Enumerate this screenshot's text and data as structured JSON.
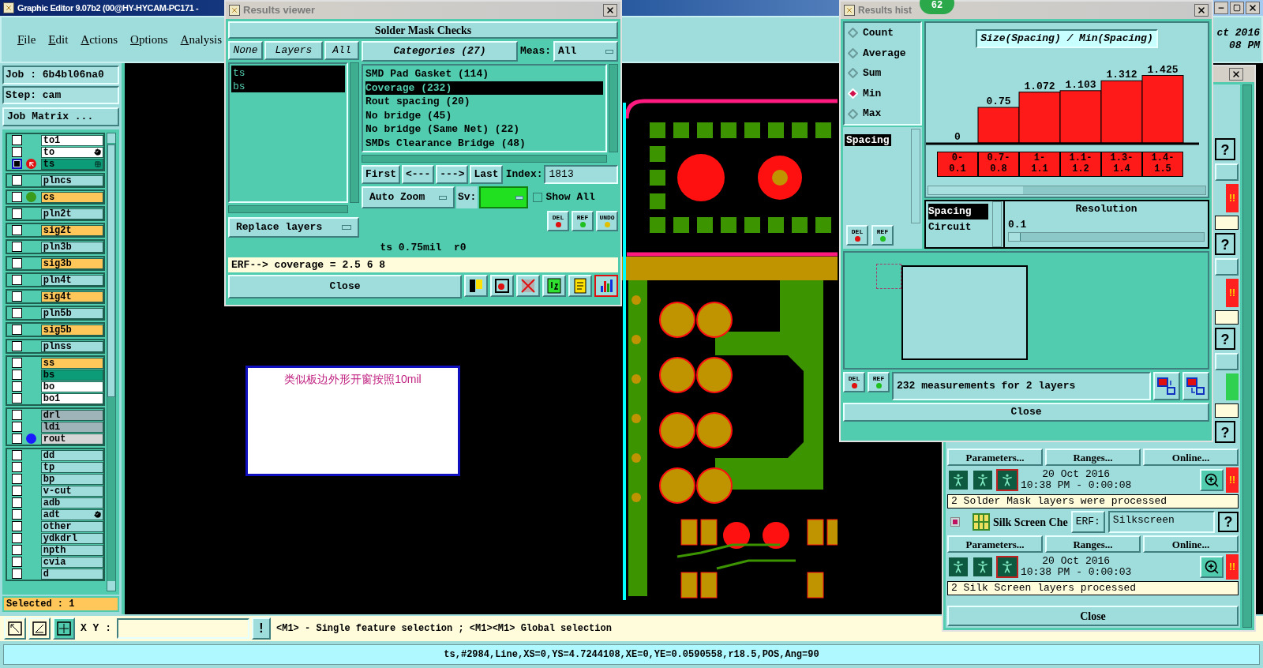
{
  "main_window": {
    "title": "Graphic Editor 9.07b2 (00@HY-HYCAM-PC171 -",
    "menu": [
      "File",
      "Edit",
      "Actions",
      "Options",
      "Analysis"
    ],
    "clock": [
      "ct 2016",
      "08 PM"
    ]
  },
  "job_panel": {
    "job": "Job : 6b4bl06na0",
    "step": "Step: cam",
    "matrix_button": "Job Matrix ...",
    "selected_count": "Selected : 1",
    "layer_groups": [
      [
        {
          "name": "to1",
          "color": "#ffffff",
          "work": false,
          "pointer": false,
          "hand": false,
          "grid": false
        },
        {
          "name": "to",
          "color": "#ffffff",
          "work": false,
          "pointer": false,
          "hand": true,
          "grid": false
        },
        {
          "name": "ts",
          "color": "#0c9c78",
          "work": true,
          "pointer": true,
          "hand": false,
          "grid": true
        }
      ],
      [
        {
          "name": "plncs",
          "color": "#9fdcdc",
          "work": false,
          "pointer": false,
          "hand": false,
          "grid": false
        }
      ],
      [
        {
          "name": "cs",
          "color": "#ffc65a",
          "work": false,
          "pointer": false,
          "hand": false,
          "grid": false,
          "dot": {
            "color": "#3a9a1a"
          }
        }
      ],
      [
        {
          "name": "pln2t",
          "color": "#9fdcdc",
          "work": false,
          "pointer": false,
          "hand": false,
          "grid": false
        }
      ],
      [
        {
          "name": "sig2t",
          "color": "#ffc65a",
          "work": false,
          "pointer": false,
          "hand": false,
          "grid": false
        }
      ],
      [
        {
          "name": "pln3b",
          "color": "#9fdcdc",
          "work": false,
          "pointer": false,
          "hand": false,
          "grid": false
        }
      ],
      [
        {
          "name": "sig3b",
          "color": "#ffc65a",
          "work": false,
          "pointer": false,
          "hand": false,
          "grid": false
        }
      ],
      [
        {
          "name": "pln4t",
          "color": "#9fdcdc",
          "work": false,
          "pointer": false,
          "hand": false,
          "grid": false
        }
      ],
      [
        {
          "name": "sig4t",
          "color": "#ffc65a",
          "work": false,
          "pointer": false,
          "hand": false,
          "grid": false
        }
      ],
      [
        {
          "name": "pln5b",
          "color": "#9fdcdc",
          "work": false,
          "pointer": false,
          "hand": false,
          "grid": false
        }
      ],
      [
        {
          "name": "sig5b",
          "color": "#ffc65a",
          "work": false,
          "pointer": false,
          "hand": false,
          "grid": false
        }
      ],
      [
        {
          "name": "plnss",
          "color": "#9fdcdc",
          "work": false,
          "pointer": false,
          "hand": false,
          "grid": false
        }
      ],
      [
        {
          "name": "ss",
          "color": "#ffc65a",
          "work": false,
          "pointer": false,
          "hand": false,
          "grid": false
        },
        {
          "name": "bs",
          "color": "#0c9c78",
          "work": false,
          "pointer": false,
          "hand": false,
          "grid": false
        },
        {
          "name": "bo",
          "color": "#ffffff",
          "work": false,
          "pointer": false,
          "hand": false,
          "grid": false
        },
        {
          "name": "bo1",
          "color": "#ffffff",
          "work": false,
          "pointer": false,
          "hand": false,
          "grid": false
        }
      ],
      [
        {
          "name": "drl",
          "color": "#9eb4b8",
          "work": false,
          "pointer": false,
          "hand": false,
          "grid": false
        },
        {
          "name": "ldi",
          "color": "#9eb4b8",
          "work": false,
          "pointer": false,
          "hand": false,
          "grid": false
        },
        {
          "name": "rout",
          "color": "#d6d6d6",
          "work": false,
          "pointer": false,
          "hand": false,
          "grid": false,
          "dot": {
            "color": "#1a1aff"
          }
        }
      ],
      [
        {
          "name": "dd",
          "color": "#9fdcdc",
          "work": false,
          "pointer": false,
          "hand": false,
          "grid": false
        },
        {
          "name": "tp",
          "color": "#9fdcdc",
          "work": false,
          "pointer": false,
          "hand": false,
          "grid": false
        },
        {
          "name": "bp",
          "color": "#9fdcdc",
          "work": false,
          "pointer": false,
          "hand": false,
          "grid": false
        },
        {
          "name": "v-cut",
          "color": "#9fdcdc",
          "work": false,
          "pointer": false,
          "hand": false,
          "grid": false
        },
        {
          "name": "adb",
          "color": "#9fdcdc",
          "work": false,
          "pointer": false,
          "hand": false,
          "grid": false
        },
        {
          "name": "adt",
          "color": "#9fdcdc",
          "work": false,
          "pointer": false,
          "hand": true,
          "grid": false
        },
        {
          "name": "other",
          "color": "#9fdcdc",
          "work": false,
          "pointer": false,
          "hand": false,
          "grid": false
        },
        {
          "name": "ydkdrl",
          "color": "#9fdcdc",
          "work": false,
          "pointer": false,
          "hand": false,
          "grid": false
        },
        {
          "name": "npth",
          "color": "#9fdcdc",
          "work": false,
          "pointer": false,
          "hand": false,
          "grid": false
        },
        {
          "name": "cvia",
          "color": "#9fdcdc",
          "work": false,
          "pointer": false,
          "hand": false,
          "grid": false
        },
        {
          "name": "d",
          "color": "#9fdcdc",
          "work": false,
          "pointer": false,
          "hand": false,
          "grid": false
        }
      ]
    ]
  },
  "canvas": {
    "note": "类似板边外形开窗按照10mil"
  },
  "results_viewer": {
    "title": "Results viewer",
    "header": "Solder Mask Checks",
    "layer_buttons": [
      "None",
      "Layers",
      "All"
    ],
    "layers": [
      {
        "label": "ts",
        "selected": true
      },
      {
        "label": "bs",
        "selected": true
      }
    ],
    "categories_button": "Categories (27)",
    "meas_label": "Meas:",
    "meas_value": "All",
    "categories": [
      {
        "label": "SMD Pad Gasket (114)",
        "selected": false
      },
      {
        "label": "Coverage (232)",
        "selected": true
      },
      {
        "label": "Rout spacing (20)",
        "selected": false
      },
      {
        "label": "No bridge (45)",
        "selected": false
      },
      {
        "label": "No bridge (Same Net) (22)",
        "selected": false
      },
      {
        "label": "SMDs Clearance Bridge (48)",
        "selected": false
      }
    ],
    "nav": [
      "First",
      "<---",
      "--->",
      "Last"
    ],
    "index_label": "Index:",
    "index_value": "1813",
    "zoom_mode": "Auto Zoom",
    "sv_label": "Sv:",
    "show_all": {
      "label": "Show All",
      "checked": false
    },
    "replace": "Replace layers",
    "actions": [
      "DEL",
      "REF",
      "UNDO"
    ],
    "info": "ts 0.75mil  r0",
    "erf": "ERF--> coverage = 2.5 6 8",
    "close": "Close",
    "tools": [
      {
        "kind": "layers",
        "selected": false
      },
      {
        "kind": "marker",
        "selected": false
      },
      {
        "kind": "no-ref",
        "selected": false
      },
      {
        "kind": "numbers",
        "selected": false
      },
      {
        "kind": "report",
        "selected": false
      },
      {
        "kind": "histogram",
        "selected": true
      }
    ]
  },
  "histogram": {
    "title": "Results hist",
    "badge": "62",
    "modes": [
      {
        "label": "Count",
        "selected": false
      },
      {
        "label": "Average",
        "selected": false
      },
      {
        "label": "Sum",
        "selected": false
      },
      {
        "label": "Min",
        "selected": true
      },
      {
        "label": "Max",
        "selected": false
      }
    ],
    "measures": [
      {
        "label": "Spacing",
        "selected": true
      }
    ],
    "actions": [
      "DEL",
      "REF"
    ],
    "chart_data": {
      "type": "bar",
      "title": "Size(Spacing) / Min(Spacing)",
      "categories": [
        "0-0.1",
        "0.7-0.8",
        "1-1.1",
        "1.1-1.2",
        "1.3-1.4",
        "1.4-1.5"
      ],
      "values": [
        0,
        0.75,
        1.072,
        1.103,
        1.312,
        1.425
      ],
      "value_labels": [
        "0",
        "0.75",
        "1.072",
        "1.103",
        "1.312",
        "1.425"
      ]
    },
    "columns": [
      {
        "label": "Spacing",
        "selected": true
      },
      {
        "label": "Circuit",
        "selected": false
      }
    ],
    "resolution": {
      "label": "Resolution",
      "value": "0.1",
      "level": 0.06
    },
    "bottom_actions": [
      "DEL",
      "REF"
    ],
    "summary": "232 measurements for 2 layers",
    "close": "Close"
  },
  "checklist": {
    "edge_items": [
      {
        "kind": "help",
        "label": "?"
      },
      {
        "kind": "blank"
      },
      {
        "kind": "alert",
        "label": "!!"
      },
      {
        "kind": "note"
      },
      {
        "kind": "help",
        "label": "?"
      },
      {
        "kind": "blank"
      },
      {
        "kind": "alert",
        "label": "!!"
      },
      {
        "kind": "note"
      },
      {
        "kind": "help",
        "label": "?"
      },
      {
        "kind": "blank"
      },
      {
        "kind": "ok"
      },
      {
        "kind": "note"
      },
      {
        "kind": "help",
        "label": "?"
      }
    ],
    "checks": [
      {
        "kind": "partial",
        "buttons": [
          "Parameters...",
          "Ranges...",
          "Online..."
        ],
        "date": "20 Oct 2016",
        "time": "10:38 PM - 0:00:08",
        "status_label": "!!",
        "message": "2 Solder Mask layers were processed"
      },
      {
        "kind": "full",
        "enabled": true,
        "name": "Silk Screen Che",
        "erf_label": "ERF:",
        "erf_value": "Silkscreen",
        "help": "?",
        "buttons": [
          "Parameters...",
          "Ranges...",
          "Online..."
        ],
        "date": "20 Oct 2016",
        "time": "10:38 PM - 0:00:03",
        "status_label": "!!",
        "message": "2 Silk Screen layers processed"
      }
    ],
    "close": "Close"
  },
  "bottom_bar": {
    "xy_label": "X Y :",
    "alert": "!",
    "hint": "<M1> - Single feature selection ; <M1><M1> Global selection"
  },
  "status_bar": "ts,#2984,Line,XS=0,YS=4.7244108,XE=0,YE=0.0590558,r18.5,POS,Ang=90"
}
